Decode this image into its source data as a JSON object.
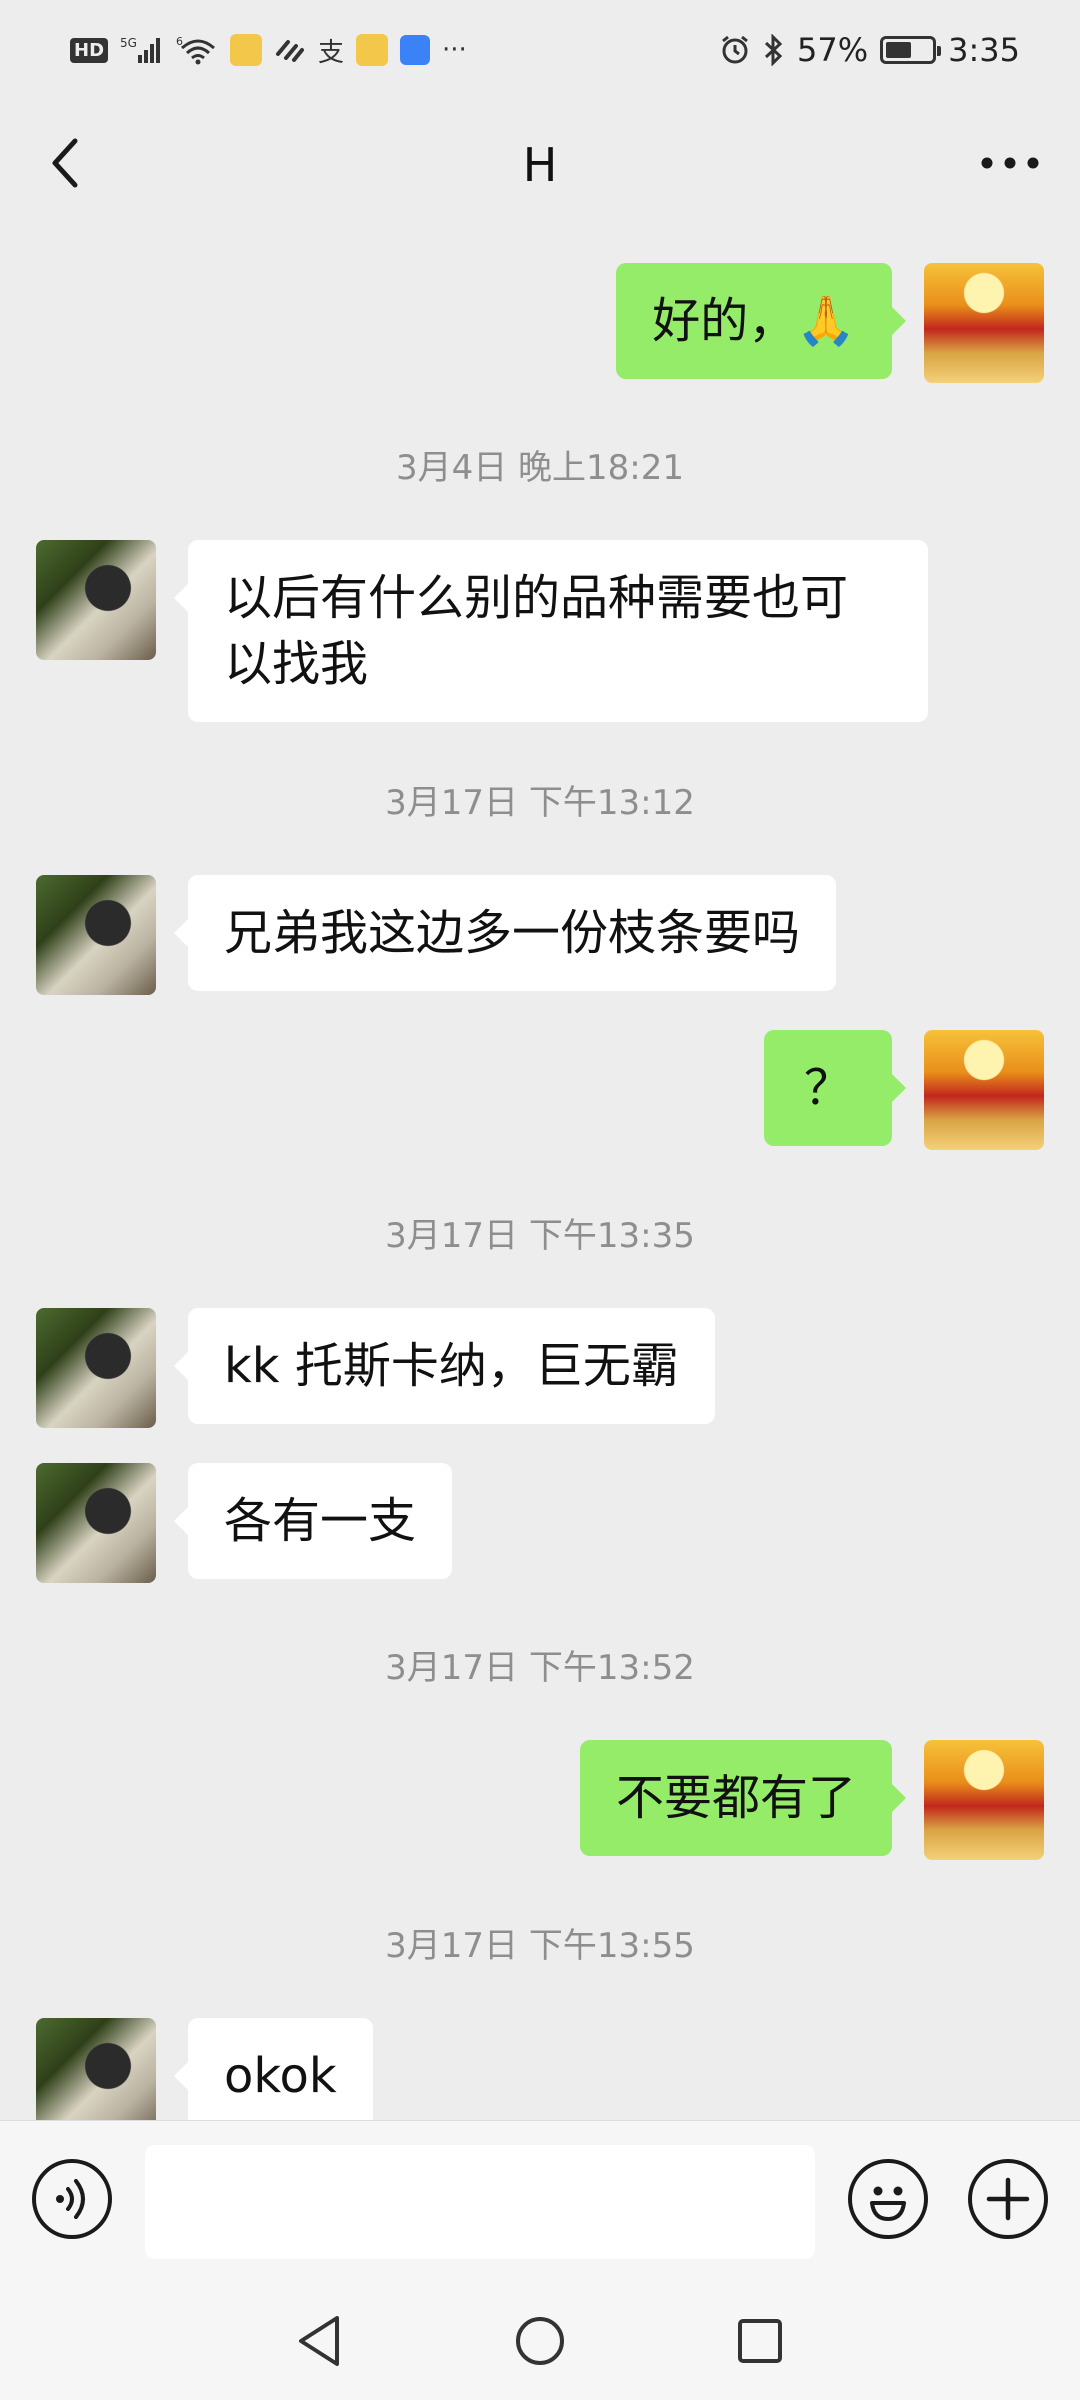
{
  "status_bar": {
    "hd": "HD",
    "net_5g": "5G",
    "net_6": "6",
    "alipay": "支",
    "more": "···",
    "battery": "57%",
    "battery_level": 0.57,
    "time": "3:35"
  },
  "header": {
    "title": "H"
  },
  "messages": [
    {
      "type": "out",
      "text": "好的，🙏"
    },
    {
      "type": "time",
      "text": "3月4日 晚上18:21"
    },
    {
      "type": "in",
      "text": "以后有什么别的品种需要也可以找我"
    },
    {
      "type": "time",
      "text": "3月17日 下午13:12"
    },
    {
      "type": "in",
      "text": "兄弟我这边多一份枝条要吗"
    },
    {
      "type": "out",
      "text": "？"
    },
    {
      "type": "time",
      "text": "3月17日 下午13:35"
    },
    {
      "type": "in",
      "text": "kk 托斯卡纳，巨无霸"
    },
    {
      "type": "in",
      "text": "各有一支"
    },
    {
      "type": "time",
      "text": "3月17日 下午13:52"
    },
    {
      "type": "out",
      "text": "不要都有了"
    },
    {
      "type": "time",
      "text": "3月17日 下午13:55"
    },
    {
      "type": "in",
      "text": "okok"
    }
  ],
  "input": {
    "value": "",
    "placeholder": ""
  },
  "icons": {
    "back": "back-icon",
    "more": "more-icon",
    "voice": "voice-icon",
    "emoji": "emoji-icon",
    "plus": "plus-icon",
    "nav_back": "nav-back-icon",
    "nav_home": "nav-home-icon",
    "nav_recent": "nav-recent-icon"
  },
  "colors": {
    "outgoing_bubble": "#95ec69",
    "incoming_bubble": "#ffffff",
    "background": "#ededed"
  }
}
